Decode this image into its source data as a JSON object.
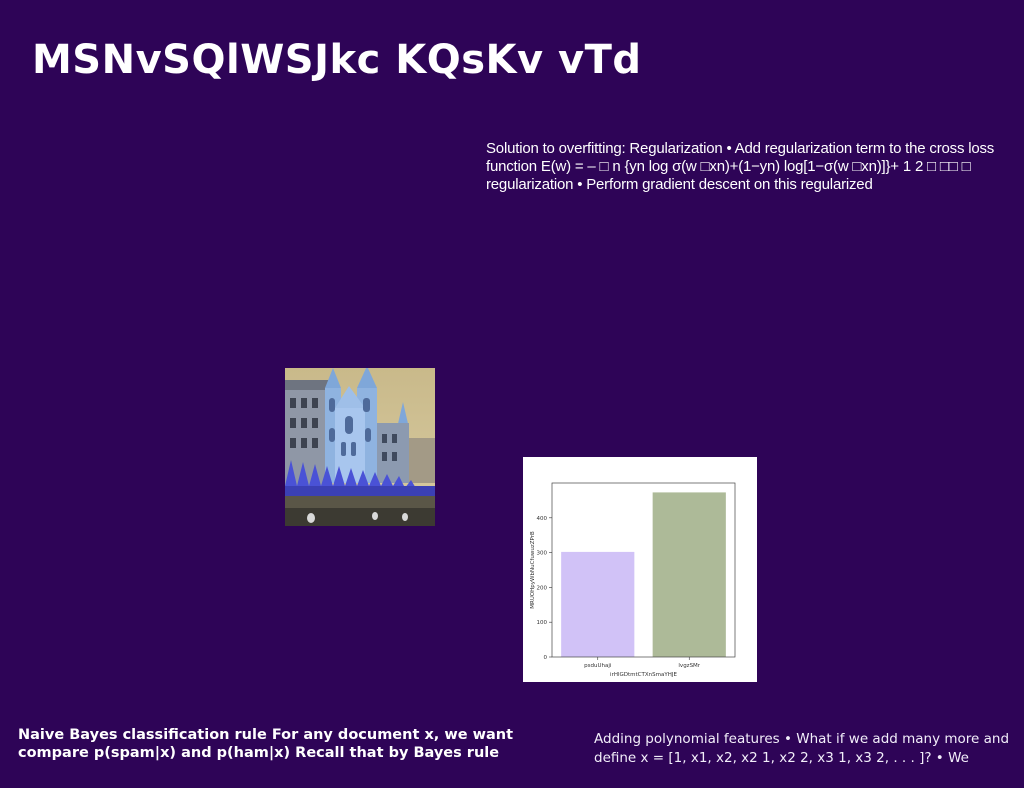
{
  "slide": {
    "title": "MSNvSQlWSJkc KQsKv vTd",
    "text_block": "Solution to overfitting: Regularization • Add regularization term to the cross loss function E(w) = – □ n {yn log σ(w □xn)+(1−yn) log[1−σ(w □xn)]}+ 1 2 □ □□ □ regularization • Perform gradient descent on this regularized",
    "bottom_left": "Naive Bayes classification rule For any document x, we want compare p(spam|x) and p(ham|x) Recall that by Bayes rule",
    "bottom_right": "Adding polynomial features • What if we add many more and define x = [1, x1, x2, x2 1, x2 2, x3 1, x3 2, . . . ]? • We"
  },
  "chart_data": {
    "type": "bar",
    "categories": [
      "psduUhaji",
      "lvgzSMr"
    ],
    "values": [
      302,
      473
    ],
    "colors": [
      "#d1c2f7",
      "#adba98"
    ],
    "xlabel": "irHlGDtmtCTXnSmaYHJE",
    "ylabel": "MRUOHpyWbNuCfuwuzZPrB",
    "yticks": [
      0,
      100,
      200,
      300,
      400
    ],
    "ylim": [
      0,
      500
    ],
    "grid": false
  }
}
